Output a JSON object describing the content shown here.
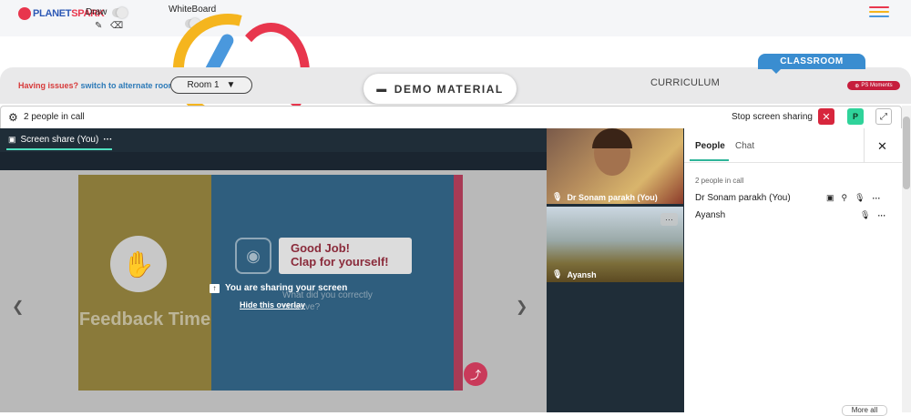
{
  "topbar": {
    "logo_text_a": "PLANET",
    "logo_text_b": "SPARK",
    "draw_label": "Draw",
    "whiteboard_label": "WhiteBoard",
    "menu_colors": [
      "#e8364d",
      "#f5b51e",
      "#4a98dd"
    ]
  },
  "controls": {
    "having_issues": "Having issues?",
    "alternate_room": "switch to alternate room",
    "room_selected": "Room 1",
    "demo_material": "DEMO MATERIAL",
    "curriculum": "CURRICULUM",
    "classroom": "CLASSROOM",
    "ps_moments": "PS Moments"
  },
  "call": {
    "people_count": "2 people in call",
    "stop_sharing": "Stop screen sharing",
    "avatar_letter": "P"
  },
  "share": {
    "tab_label": "Screen share (You)",
    "tab_menu": "···",
    "sharing_message": "You are sharing your screen",
    "hide_overlay": "Hide this overlay",
    "slide_feedback": "Feedback Time",
    "slide_goodjob_1": "Good Job!",
    "slide_goodjob_2": "Clap for yourself!",
    "slide_question": "What did you correctly observe?"
  },
  "videos": [
    {
      "name": "Dr Sonam parakh (You)"
    },
    {
      "name": "Ayansh",
      "more": "···"
    }
  ],
  "panel": {
    "tab_people": "People",
    "tab_chat": "Chat",
    "in_call": "2 people in call",
    "people": [
      {
        "name": "Dr Sonam parakh (You)"
      },
      {
        "name": "Ayansh"
      }
    ],
    "more_button": "More all"
  },
  "colors": {
    "accent_teal": "#2fb59a",
    "stop_red": "#d7263d",
    "classroom_blue": "#3a8dd0",
    "brand_red": "#e8364d"
  }
}
